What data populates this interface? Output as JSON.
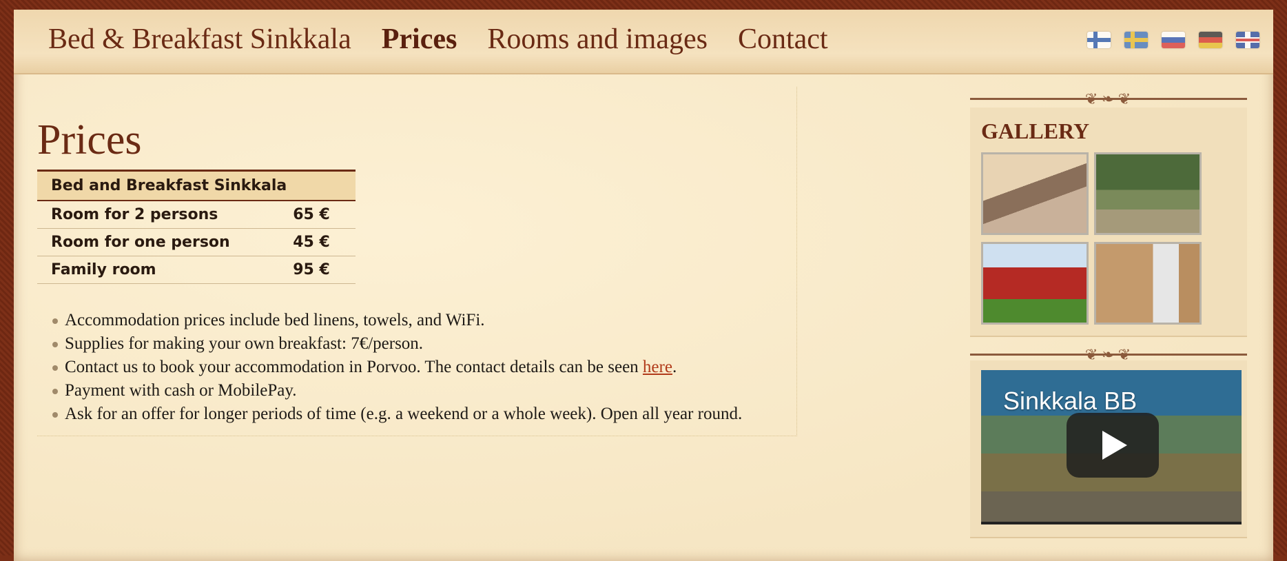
{
  "nav": {
    "items": [
      {
        "label": "Bed & Breakfast Sinkkala",
        "active": false
      },
      {
        "label": "Prices",
        "active": true
      },
      {
        "label": "Rooms and images",
        "active": false
      },
      {
        "label": "Contact",
        "active": false
      }
    ],
    "languages": [
      {
        "icon": "finland-flag-icon"
      },
      {
        "icon": "sweden-flag-icon"
      },
      {
        "icon": "russia-flag-icon"
      },
      {
        "icon": "germany-flag-icon"
      },
      {
        "icon": "uk-flag-icon"
      }
    ]
  },
  "main": {
    "title": "Prices",
    "table": {
      "header": "Bed and Breakfast Sinkkala",
      "rows": [
        {
          "room": "Room for 2 persons",
          "price": "65 €"
        },
        {
          "room": "Room for one person",
          "price": "45 €"
        },
        {
          "room": "Family room",
          "price": "95 €"
        }
      ]
    },
    "notes": [
      "Accommodation prices include bed linens, towels, and WiFi.",
      "Supplies for making your own breakfast: 7€/person.",
      "Contact us to book your accommodation in Porvoo. The contact details can be seen ",
      "Payment with cash or MobilePay.",
      "Ask for an offer for longer periods of time (e.g. a weekend or a whole week). Open all year round."
    ],
    "contact_link": "here",
    "contact_suffix": "."
  },
  "sidebar": {
    "gallery_title": "GALLERY",
    "video_title": "Sinkkala BB"
  },
  "colors": {
    "accent": "#6a2a14",
    "link": "#b13a1a",
    "background": "#f8e9c8"
  }
}
